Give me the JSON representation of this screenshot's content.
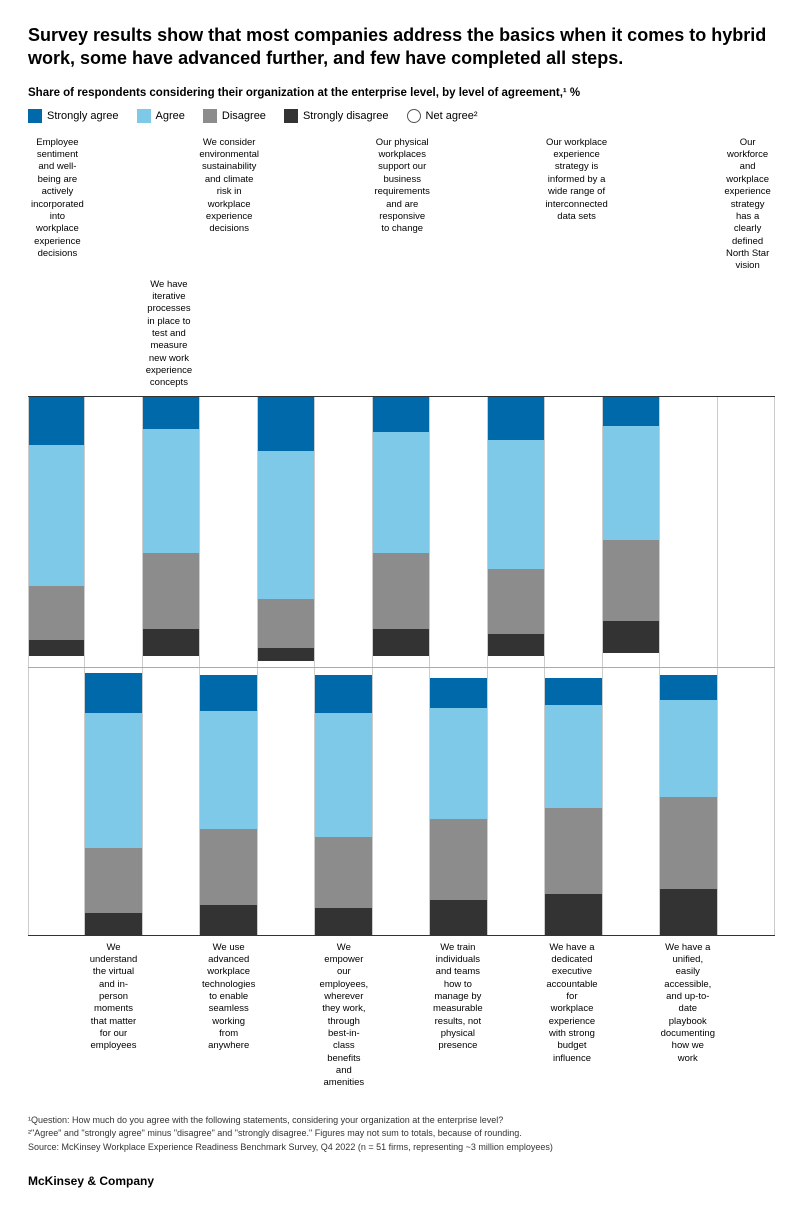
{
  "title": "Survey results show that most companies address the basics when it comes to hybrid work, some have advanced further, and few have completed all steps.",
  "subtitle": "Share of respondents considering their organization at the enterprise level, by level of agreement,¹ %",
  "legend": [
    {
      "label": "Strongly agree",
      "color": "#0069AA",
      "type": "solid"
    },
    {
      "label": "Agree",
      "color": "#7FC9E8",
      "type": "solid"
    },
    {
      "label": "Disagree",
      "color": "#8C8C8C",
      "type": "solid"
    },
    {
      "label": "Strongly disagree",
      "color": "#333333",
      "type": "solid"
    },
    {
      "label": "Net agree²",
      "type": "circle"
    }
  ],
  "top_columns": [
    {
      "label": "Employee sentiment and well-being are actively incorporated into workplace experience decisions",
      "bars": [
        {
          "color": "#0069AA",
          "pct": 18
        },
        {
          "color": "#7FC9E8",
          "pct": 52
        },
        {
          "color": "#8C8C8C",
          "pct": 20
        },
        {
          "color": "#333333",
          "pct": 6
        }
      ]
    },
    {
      "label": "We consider environmental sustainability and climate risk in workplace experience decisions",
      "bars": [
        {
          "color": "#0069AA",
          "pct": 12
        },
        {
          "color": "#7FC9E8",
          "pct": 46
        },
        {
          "color": "#8C8C8C",
          "pct": 28
        },
        {
          "color": "#333333",
          "pct": 10
        }
      ]
    },
    {
      "label": "Our physical workplaces support our business requirements and are responsive to change",
      "bars": [
        {
          "color": "#0069AA",
          "pct": 20
        },
        {
          "color": "#7FC9E8",
          "pct": 55
        },
        {
          "color": "#8C8C8C",
          "pct": 18
        },
        {
          "color": "#333333",
          "pct": 5
        }
      ]
    },
    {
      "label": "Our workplace experience strategy is informed by a wide range of interconnected data sets",
      "bars": [
        {
          "color": "#0069AA",
          "pct": 13
        },
        {
          "color": "#7FC9E8",
          "pct": 45
        },
        {
          "color": "#8C8C8C",
          "pct": 28
        },
        {
          "color": "#333333",
          "pct": 10
        }
      ]
    },
    {
      "label": "Our workforce and workplace experience strategy has a clearly defined North Star vision",
      "bars": [
        {
          "color": "#0069AA",
          "pct": 16
        },
        {
          "color": "#7FC9E8",
          "pct": 48
        },
        {
          "color": "#8C8C8C",
          "pct": 24
        },
        {
          "color": "#333333",
          "pct": 8
        }
      ]
    },
    {
      "label": "We have iterative processes in place to test and measure new work experience concepts",
      "bars": [
        {
          "color": "#0069AA",
          "pct": 11
        },
        {
          "color": "#7FC9E8",
          "pct": 42
        },
        {
          "color": "#8C8C8C",
          "pct": 30
        },
        {
          "color": "#333333",
          "pct": 12
        }
      ]
    }
  ],
  "bottom_columns": [
    {
      "label": "We understand the virtual and in-person moments that matter for our employees",
      "bars": [
        {
          "color": "#0069AA",
          "pct": 15
        },
        {
          "color": "#7FC9E8",
          "pct": 50
        },
        {
          "color": "#8C8C8C",
          "pct": 24
        },
        {
          "color": "#333333",
          "pct": 8
        }
      ]
    },
    {
      "label": "We use advanced workplace technologies to enable seamless working from anywhere",
      "bars": [
        {
          "color": "#0069AA",
          "pct": 13
        },
        {
          "color": "#7FC9E8",
          "pct": 44
        },
        {
          "color": "#8C8C8C",
          "pct": 28
        },
        {
          "color": "#333333",
          "pct": 11
        }
      ]
    },
    {
      "label": "We empower our employees, wherever they work, through best-in-class benefits and amenities",
      "bars": [
        {
          "color": "#0069AA",
          "pct": 14
        },
        {
          "color": "#7FC9E8",
          "pct": 46
        },
        {
          "color": "#8C8C8C",
          "pct": 26
        },
        {
          "color": "#333333",
          "pct": 10
        }
      ]
    },
    {
      "label": "We train individuals and teams how to manage by measurable results, not physical presence",
      "bars": [
        {
          "color": "#0069AA",
          "pct": 11
        },
        {
          "color": "#7FC9E8",
          "pct": 41
        },
        {
          "color": "#8C8C8C",
          "pct": 30
        },
        {
          "color": "#333333",
          "pct": 13
        }
      ]
    },
    {
      "label": "We have a dedicated executive accountable for workplace experience with strong budget influence",
      "bars": [
        {
          "color": "#0069AA",
          "pct": 10
        },
        {
          "color": "#7FC9E8",
          "pct": 38
        },
        {
          "color": "#8C8C8C",
          "pct": 32
        },
        {
          "color": "#333333",
          "pct": 15
        }
      ]
    },
    {
      "label": "We have a unified, easily accessible, and up-to-date playbook documenting how we work",
      "bars": [
        {
          "color": "#0069AA",
          "pct": 9
        },
        {
          "color": "#7FC9E8",
          "pct": 36
        },
        {
          "color": "#8C8C8C",
          "pct": 34
        },
        {
          "color": "#333333",
          "pct": 17
        }
      ]
    }
  ],
  "footnotes": [
    "¹Question: How much do you agree with the following statements, considering your organization at the enterprise level?",
    "²\"Agree\" and \"strongly agree\" minus \"disagree\" and \"strongly disagree.\" Figures may not sum to totals, because of rounding.",
    "Source: McKinsey Workplace Experience Readiness Benchmark Survey, Q4 2022 (n = 51 firms, representing ~3 million employees)"
  ],
  "brand": "McKinsey & Company"
}
